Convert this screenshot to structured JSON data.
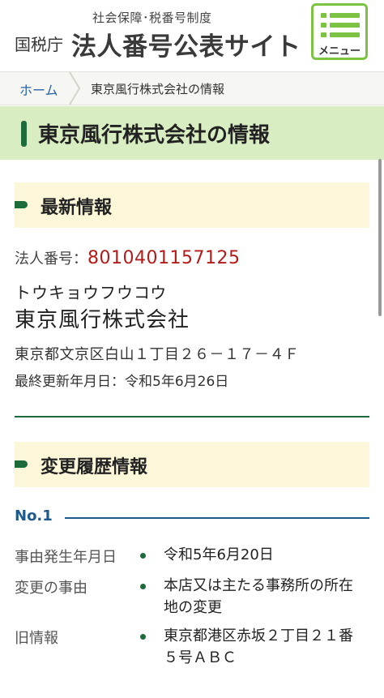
{
  "header": {
    "subtitle": "社会保障･税番号制度",
    "agency": "国税庁",
    "site_name": "法人番号公表サイト",
    "menu_label": "メニュー"
  },
  "breadcrumb": {
    "home": "ホーム",
    "current": "東京風行株式会社の情報"
  },
  "page_title": "東京風行株式会社の情報",
  "latest": {
    "heading": "最新情報",
    "number_label": "法人番号：",
    "number": "8010401157125",
    "kana": "トウキョウフウコウ",
    "name": "東京風行株式会社",
    "address": "東京都文京区白山１丁目２６－１７－４Ｆ",
    "updated": "最終更新年月日：令和5年6月26日"
  },
  "history": {
    "heading": "変更履歴情報",
    "entries": [
      {
        "no": "No.1",
        "date_label": "事由発生年月日",
        "date": "令和5年6月20日",
        "reason_label": "変更の事由",
        "reason_line1": "本店又は主たる事務所の所在",
        "reason_line2": "地の変更",
        "old_label": "旧情報",
        "old_line1": "東京都港区赤坂２丁目２１番",
        "old_line2": "５号ＡＢＣ"
      }
    ]
  },
  "colors": {
    "accent_green": "#7cc243",
    "dark_green": "#1d6a3a",
    "number_red": "#b31b1b",
    "link_blue": "#2b62a7",
    "title_bg": "#d8edc2",
    "section_bg": "#fcf7d8"
  },
  "icons": {
    "menu": "hamburger-list-icon",
    "breadcrumb_separator": "chevron-right-icon"
  }
}
